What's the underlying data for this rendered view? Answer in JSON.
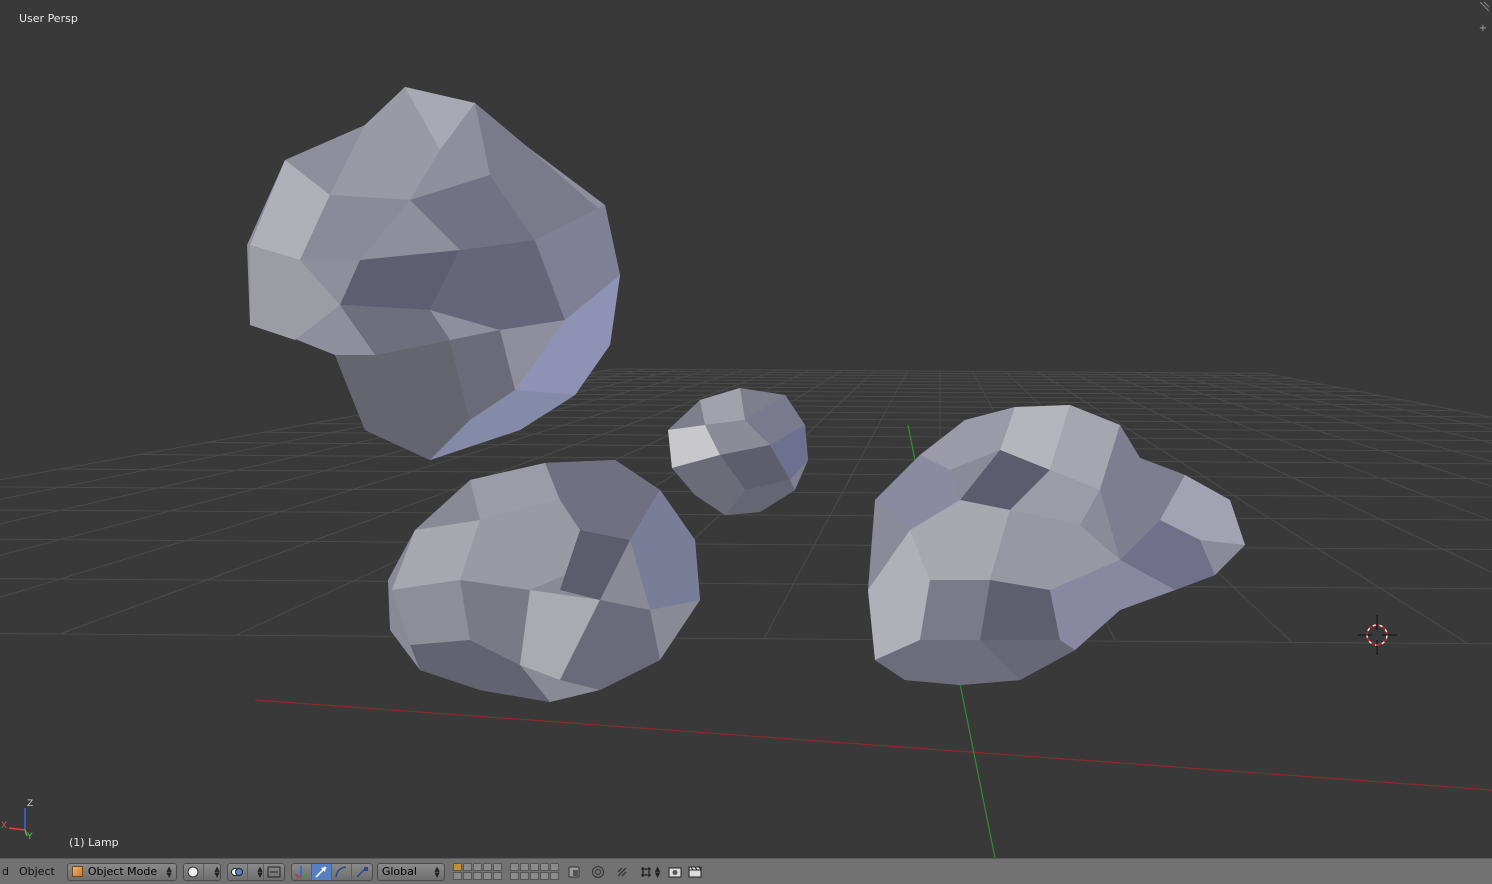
{
  "viewport": {
    "view_label": "User Persp",
    "object_label": "(1) Lamp",
    "axes": {
      "z": "Z",
      "y": "Y",
      "x": "X"
    }
  },
  "header": {
    "menu_truncated": "d",
    "menu_object": "Object",
    "mode": "Object Mode",
    "orientation": "Global"
  },
  "colors": {
    "background": "#393939",
    "grid": "#4a4a4a",
    "x_axis": "#8a2a2a",
    "y_axis": "#2a8a2a",
    "header": "#727272",
    "active_button": "#5680c2",
    "mesh_base": "#8c8ca0"
  },
  "icons": [
    "viewport-shading-icon",
    "pivot-icon",
    "manipulator-icon",
    "translate-icon",
    "rotate-icon",
    "scale-icon",
    "proportional-icon",
    "snap-icon",
    "render-icon",
    "camera-icon"
  ]
}
